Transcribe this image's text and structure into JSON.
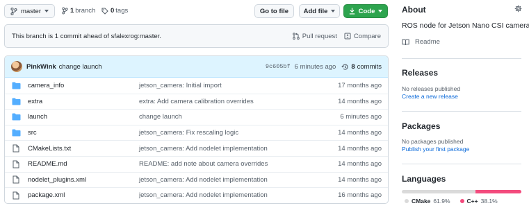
{
  "toolbar": {
    "branch": "master",
    "branch_count": "1",
    "branch_label": "branch",
    "tags_count": "0",
    "tags_label": "tags",
    "go_to_file": "Go to file",
    "add_file": "Add file",
    "code": "Code"
  },
  "banner": {
    "text": "This branch is 1 commit ahead of sfalexrog:master.",
    "pull_request": "Pull request",
    "compare": "Compare"
  },
  "latest_commit": {
    "author": "PinkWink",
    "message": "change launch",
    "sha": "9c605bf",
    "ago": "6 minutes ago",
    "commit_count": "8",
    "commits_label": "commits"
  },
  "files": [
    {
      "name": "camera_info",
      "type": "folder",
      "message": "jetson_camera: Initial import",
      "age": "17 months ago"
    },
    {
      "name": "extra",
      "type": "folder",
      "message": "extra: Add camera calibration overrides",
      "age": "14 months ago"
    },
    {
      "name": "launch",
      "type": "folder",
      "message": "change launch",
      "age": "6 minutes ago"
    },
    {
      "name": "src",
      "type": "folder",
      "message": "jetson_camera: Fix rescaling logic",
      "age": "14 months ago"
    },
    {
      "name": "CMakeLists.txt",
      "type": "file",
      "message": "jetson_camera: Add nodelet implementation",
      "age": "14 months ago"
    },
    {
      "name": "README.md",
      "type": "file",
      "message": "README: add note about camera overrides",
      "age": "14 months ago"
    },
    {
      "name": "nodelet_plugins.xml",
      "type": "file",
      "message": "jetson_camera: Add nodelet implementation",
      "age": "14 months ago"
    },
    {
      "name": "package.xml",
      "type": "file",
      "message": "jetson_camera: Add nodelet implementation",
      "age": "16 months ago"
    }
  ],
  "sidebar": {
    "about_title": "About",
    "description": "ROS node for Jetson Nano CSI camera",
    "readme": "Readme",
    "releases_title": "Releases",
    "releases_none": "No releases published",
    "releases_link": "Create a new release",
    "packages_title": "Packages",
    "packages_none": "No packages published",
    "packages_link": "Publish your first package",
    "languages_title": "Languages",
    "languages": [
      {
        "name": "CMake",
        "percent": "61.9%",
        "value": 61.9,
        "color": "#dadada"
      },
      {
        "name": "C++",
        "percent": "38.1%",
        "value": 38.1,
        "color": "#f34b7d"
      }
    ]
  },
  "colors": {
    "accent_green": "#2da44e",
    "link_blue": "#0969da",
    "folder_blue": "#54aeff"
  }
}
